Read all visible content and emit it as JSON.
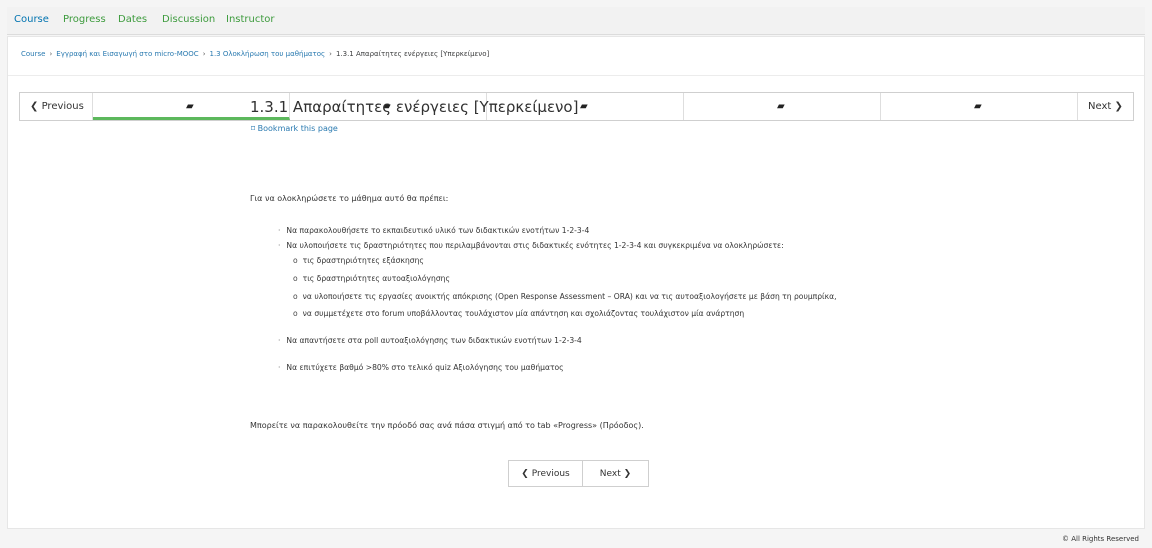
{
  "top_nav": {
    "tabs": [
      {
        "label": "Course",
        "active": true
      },
      {
        "label": "Progress",
        "active": false
      },
      {
        "label": "Dates",
        "active": false
      },
      {
        "label": "Discussion",
        "active": false
      },
      {
        "label": "Instructor",
        "active": false
      }
    ]
  },
  "breadcrumb": {
    "items": [
      "Course",
      "Εγγραφή και Εισαγωγή στο micro-MOOC",
      "1.3 Ολοκλήρωση του μαθήματος",
      "1.3.1 Απαραίτητες ενέργειες [Υπερκείμενο]"
    ],
    "separator": "›"
  },
  "sequence_nav": {
    "previous_label": "Previous",
    "next_label": "Next",
    "units": [
      {
        "icon": "book-icon",
        "active": true
      },
      {
        "icon": "book-icon",
        "active": false
      },
      {
        "icon": "book-icon",
        "active": false
      },
      {
        "icon": "book-icon",
        "active": false
      },
      {
        "icon": "book-icon",
        "active": false
      }
    ]
  },
  "unit": {
    "title": "1.3.1 Απαραίτητες ενέργειες [Υπερκείμενο]",
    "bookmark_label": "Bookmark this page",
    "intro": "Για να ολοκληρώσετε το μάθημα αυτό θα πρέπει:",
    "list": [
      "Να παρακολουθήσετε το εκπαιδευτικό υλικό των διδακτικών ενοτήτων 1-2-3-4",
      "Να υλοποιήσετε τις δραστηριότητες που περιλαμβάνονται στις διδακτικές ενότητες 1-2-3-4 και συγκεκριμένα να ολοκληρώσετε:",
      "Να απαντήσετε στα poll αυτοαξιολόγησης των διδακτικών ενοτήτων 1-2-3-4",
      "Να επιτύχετε βαθμό >80% στο τελικό quiz Αξιολόγησης του μαθήματος"
    ],
    "sublist": [
      "τις δραστηριότητες εξάσκησης",
      "τις δραστηριότητες αυτοαξιολόγησης",
      "να υλοποιήσετε τις εργασίες ανοικτής απόκρισης (Open Response Assessment – ORA) και να τις αυτοαξιολογήσετε με βάση τη ρουμπρίκα,",
      "να συμμετέχετε στο forum υποβάλλοντας τουλάχιστον μία απάντηση και σχολιάζοντας τουλάχιστον μία ανάρτηση"
    ],
    "outro": "Μπορείτε να παρακολουθείτε την πρόοδό σας ανά πάσα στιγμή από το tab «Progress» (Πρόοδος)."
  },
  "bottom_nav": {
    "previous_label": "Previous",
    "next_label": "Next"
  },
  "footer": {
    "copyright": "© All Rights Reserved"
  },
  "colors": {
    "accent_green": "#5cb85c",
    "link_blue": "#2a7ab0"
  }
}
